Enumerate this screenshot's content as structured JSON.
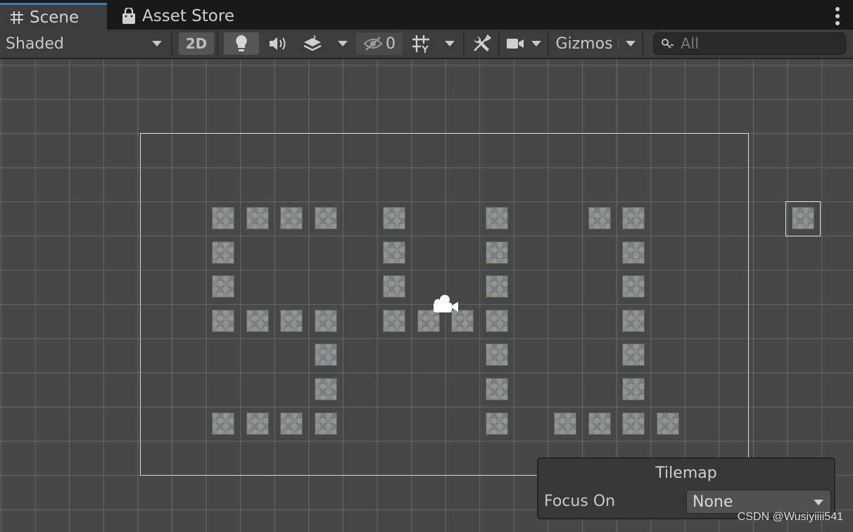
{
  "tabs": [
    {
      "label": "Scene",
      "icon": "grid-hash-icon",
      "active": true
    },
    {
      "label": "Asset Store",
      "icon": "shopping-bag-icon",
      "active": false
    }
  ],
  "toolbar": {
    "shading_mode": "Shaded",
    "mode_2d_label": "2D",
    "hidden_count": "0",
    "gizmos_label": "Gizmos",
    "search_placeholder": "All"
  },
  "tilemap_overlay": {
    "title": "Tilemap",
    "focus_label": "Focus On",
    "focus_value": "None"
  },
  "watermark": "CSDN @Wusiyiiii541",
  "colors": {
    "accent": "#3a79bb",
    "scene_bg": "#474747",
    "toolbar_bg": "#3c3c3c"
  }
}
